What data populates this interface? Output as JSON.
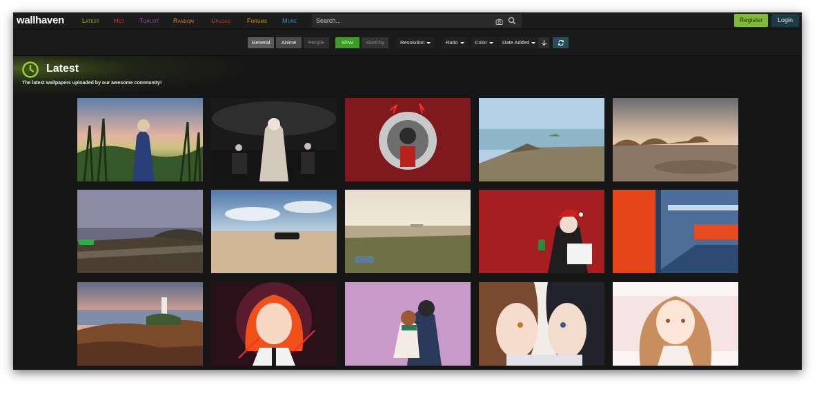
{
  "app": {
    "logo": "wallhaven"
  },
  "nav": [
    {
      "label": "Latest",
      "color": "#9cca3c"
    },
    {
      "label": "Hot",
      "color": "#d24a3a"
    },
    {
      "label": "Toplist",
      "color": "#a556c8"
    },
    {
      "label": "Random",
      "color": "#ee8434"
    },
    {
      "label": "Upload",
      "color": "#cc4438"
    },
    {
      "label": "Forums",
      "color": "#eaa424"
    },
    {
      "label": "More",
      "color": "#3c92cc"
    }
  ],
  "search": {
    "placeholder": "Search...",
    "camera_icon": "camera-icon",
    "search_icon": "search-icon"
  },
  "auth": {
    "register": "Register",
    "login": "Login"
  },
  "filters": {
    "categories": [
      "General",
      "Anime",
      "People"
    ],
    "purity": [
      "SFW",
      "Sketchy"
    ],
    "dropdowns": [
      "Resolution",
      "Ratio",
      "Color",
      "Date Added"
    ],
    "sort_icon": "arrow-down-icon",
    "refresh_icon": "refresh-icon"
  },
  "page": {
    "title": "Latest",
    "subtitle": "The latest wallpapers uploaded by our awesome community!",
    "icon": "clock-icon"
  },
  "colors": {
    "accent_green": "#82b93c",
    "sfw_green": "#3f9a2a",
    "login_blue": "#1c3a44"
  },
  "thumbnails": [
    "anime-girl-field",
    "anime-orchestra",
    "anime-character-red",
    "racing-coast",
    "racing-desert-rocks",
    "racing-car-lake",
    "racing-desert-sky",
    "racing-sunset-coast",
    "anime-santa-girl",
    "abstract-corridor",
    "lighthouse-coast",
    "anime-red-hair",
    "anime-couple-pink",
    "anime-girls-closeup",
    "anime-girl-brown-hair"
  ]
}
